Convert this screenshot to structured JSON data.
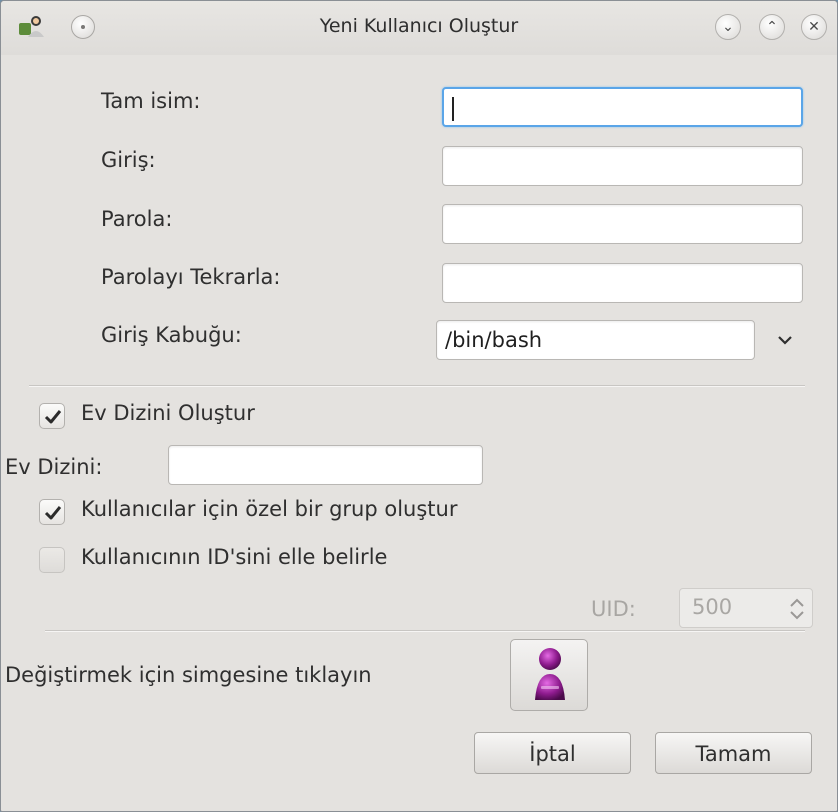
{
  "window": {
    "title": "Yeni Kullanıcı Oluştur",
    "icons": {
      "app": "user-admin-icon",
      "menu": "window-menu-icon",
      "minimize": "minimize-icon",
      "maximize": "maximize-icon",
      "close": "close-icon"
    }
  },
  "form": {
    "full_name_label": "Tam isim:",
    "full_name_value": "",
    "login_label": "Giriş:",
    "login_value": "",
    "password_label": "Parola:",
    "password_value": "",
    "password_repeat_label": "Parolayı Tekrarla:",
    "password_repeat_value": "",
    "shell_label": "Giriş Kabuğu:",
    "shell_value": "/bin/bash"
  },
  "home": {
    "create_home_label": "Ev Dizini Oluştur",
    "create_home_checked": true,
    "home_dir_label": "Ev Dizini:",
    "home_dir_value": "",
    "private_group_label": "Kullanıcılar için özel bir grup oluştur",
    "private_group_checked": true,
    "manual_uid_label": "Kullanıcının ID'sini elle belirle",
    "manual_uid_checked": false,
    "uid_label": "UID:",
    "uid_value": "500"
  },
  "avatar": {
    "hint": "Değiştirmek için simgesine tıklayın",
    "icon": "user-avatar-icon"
  },
  "buttons": {
    "cancel": "İptal",
    "ok": "Tamam"
  },
  "colors": {
    "focus": "#5aa5e8",
    "avatar": "#8e1b8e"
  }
}
